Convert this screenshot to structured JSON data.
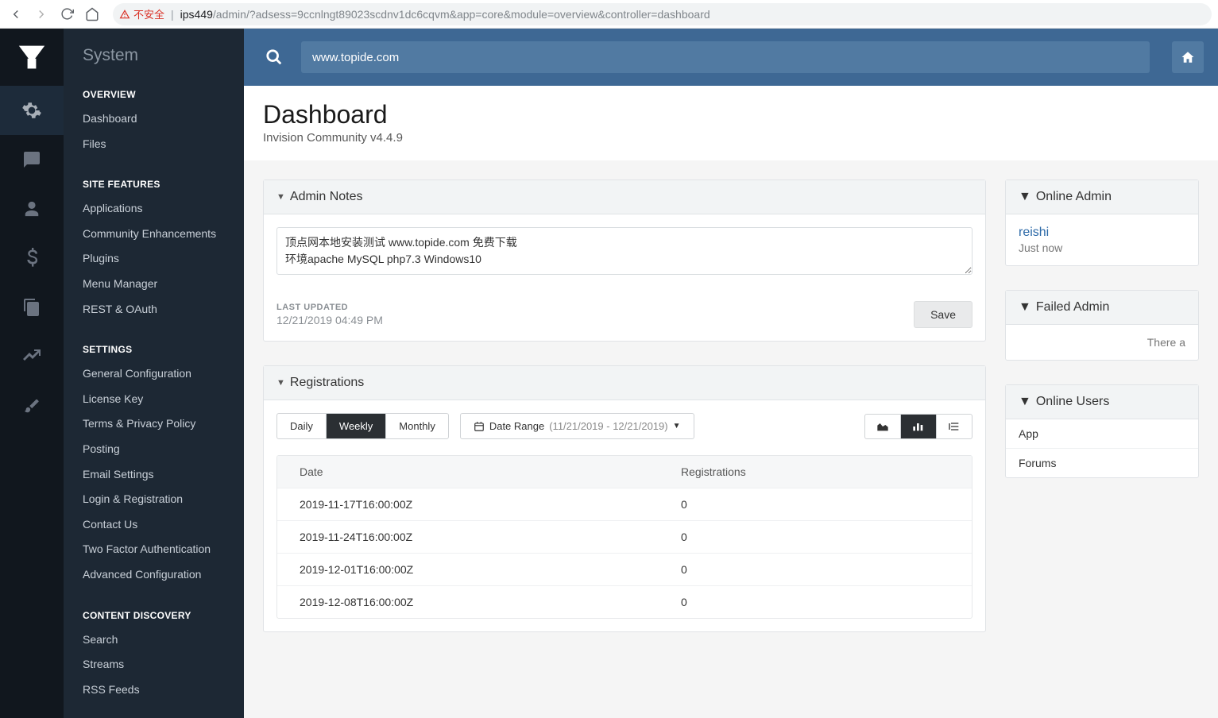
{
  "browser": {
    "insecure_label": "不安全",
    "url_host": "ips449",
    "url_path": "/admin/?adsess=9ccnlngt89023scdnv1dc6cqvm&app=core&module=overview&controller=dashboard"
  },
  "sidebar": {
    "title": "System",
    "sections": [
      {
        "head": "OVERVIEW",
        "items": [
          "Dashboard",
          "Files"
        ]
      },
      {
        "head": "SITE FEATURES",
        "items": [
          "Applications",
          "Community Enhancements",
          "Plugins",
          "Menu Manager",
          "REST & OAuth"
        ]
      },
      {
        "head": "SETTINGS",
        "items": [
          "General Configuration",
          "License Key",
          "Terms & Privacy Policy",
          "Posting",
          "Email Settings",
          "Login & Registration",
          "Contact Us",
          "Two Factor Authentication",
          "Advanced Configuration"
        ]
      },
      {
        "head": "CONTENT DISCOVERY",
        "items": [
          "Search",
          "Streams",
          "RSS Feeds"
        ]
      }
    ]
  },
  "topbar": {
    "search_value": "www.topide.com"
  },
  "page": {
    "title": "Dashboard",
    "subtitle": "Invision Community v4.4.9"
  },
  "admin_notes": {
    "panel_title": "Admin Notes",
    "text": "顶点网本地安装测试 www.topide.com 免费下载\n环境apache MySQL php7.3 Windows10",
    "last_updated_label": "LAST UPDATED",
    "last_updated_value": "12/21/2019 04:49 PM",
    "save_label": "Save"
  },
  "registrations": {
    "panel_title": "Registrations",
    "tabs": {
      "daily": "Daily",
      "weekly": "Weekly",
      "monthly": "Monthly"
    },
    "date_range_label": "Date Range",
    "date_range_value": "(11/21/2019 - 12/21/2019)",
    "columns": {
      "date": "Date",
      "count": "Registrations"
    },
    "rows": [
      {
        "date": "2019-11-17T16:00:00Z",
        "count": "0"
      },
      {
        "date": "2019-11-24T16:00:00Z",
        "count": "0"
      },
      {
        "date": "2019-12-01T16:00:00Z",
        "count": "0"
      },
      {
        "date": "2019-12-08T16:00:00Z",
        "count": "0"
      }
    ]
  },
  "side": {
    "online_admins": {
      "title": "Online Admin",
      "user": "reishi",
      "time": "Just now"
    },
    "failed_admin": {
      "title": "Failed Admin",
      "empty": "There a"
    },
    "online_users": {
      "title": "Online Users",
      "items": [
        "App",
        "Forums"
      ]
    }
  },
  "chart_data": {
    "type": "table",
    "title": "Registrations",
    "interval": "Weekly",
    "date_range": [
      "11/21/2019",
      "12/21/2019"
    ],
    "columns": [
      "Date",
      "Registrations"
    ],
    "rows": [
      [
        "2019-11-17T16:00:00Z",
        0
      ],
      [
        "2019-11-24T16:00:00Z",
        0
      ],
      [
        "2019-12-01T16:00:00Z",
        0
      ],
      [
        "2019-12-08T16:00:00Z",
        0
      ]
    ]
  }
}
